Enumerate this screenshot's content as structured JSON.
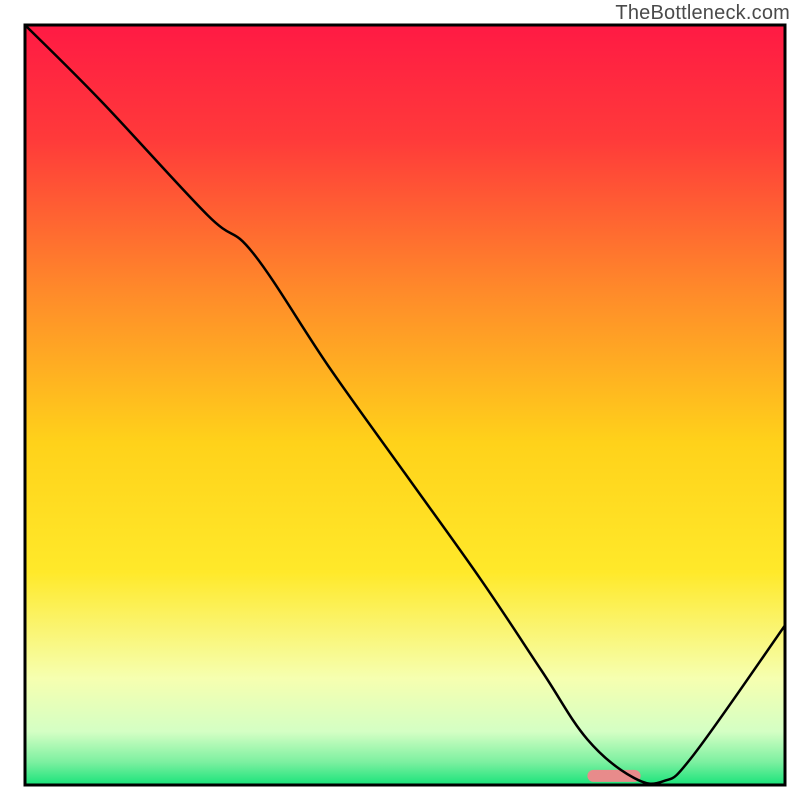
{
  "watermark": "TheBottleneck.com",
  "chart_data": {
    "type": "line",
    "title": "",
    "xlabel": "",
    "ylabel": "",
    "xlim": [
      0,
      100
    ],
    "ylim": [
      0,
      100
    ],
    "series": [
      {
        "name": "curve",
        "x": [
          0,
          10,
          24,
          30,
          40,
          50,
          60,
          68,
          74,
          80,
          84,
          88,
          100
        ],
        "y": [
          100,
          90,
          75,
          70,
          55,
          41,
          27,
          15,
          6,
          1,
          0.5,
          4,
          21
        ]
      }
    ],
    "marker": {
      "x_start": 74,
      "x_end": 81,
      "y": 1.2,
      "color": "#e88b8b"
    },
    "gradient_stops": [
      {
        "offset": 0.0,
        "color": "#ff1a44"
      },
      {
        "offset": 0.15,
        "color": "#ff3a3a"
      },
      {
        "offset": 0.35,
        "color": "#ff8a2a"
      },
      {
        "offset": 0.55,
        "color": "#ffd21a"
      },
      {
        "offset": 0.72,
        "color": "#ffe92a"
      },
      {
        "offset": 0.86,
        "color": "#f6ffb0"
      },
      {
        "offset": 0.93,
        "color": "#d4ffc4"
      },
      {
        "offset": 0.97,
        "color": "#7cf0a0"
      },
      {
        "offset": 1.0,
        "color": "#19e37a"
      }
    ],
    "border_color": "#000000",
    "border_width": 3,
    "curve_color": "#000000",
    "curve_width": 2.5
  }
}
